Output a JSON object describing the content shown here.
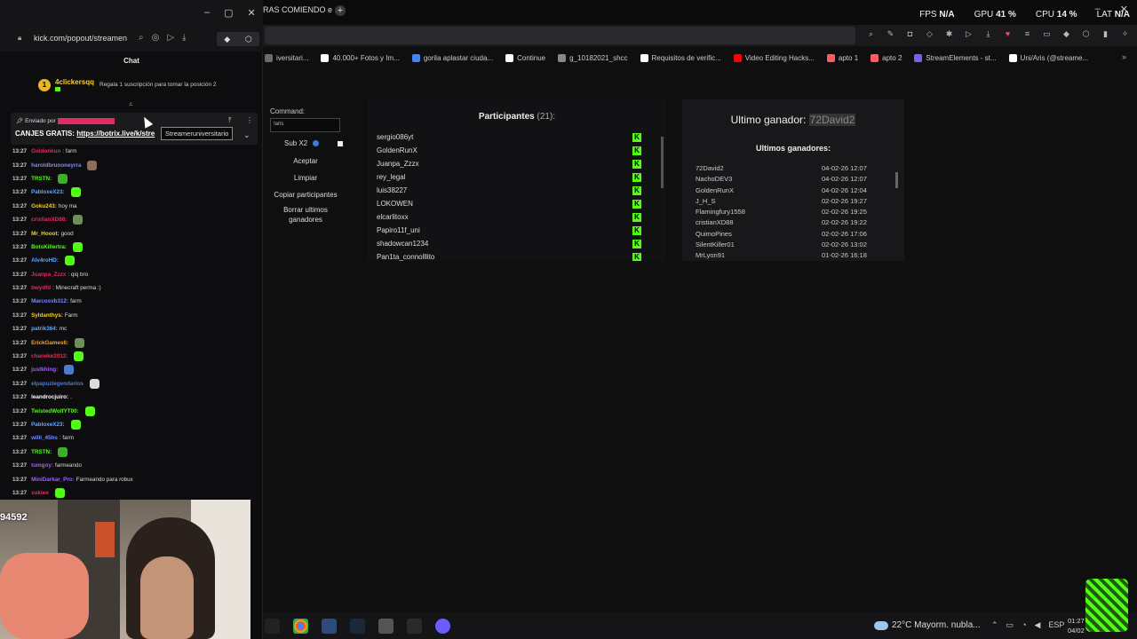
{
  "main": {
    "tab_title": "RAS COMIENDO e",
    "perf": [
      {
        "label": "FPS",
        "value": "N/A"
      },
      {
        "label": "GPU",
        "value": "41 %"
      },
      {
        "label": "CPU",
        "value": "14 %"
      },
      {
        "label": "LAT",
        "value": "N/A"
      }
    ],
    "bookmarks": [
      {
        "label": "iversitari...",
        "color": "#6b6b6b"
      },
      {
        "label": "40.000+ Fotos y Im...",
        "color": "#ffffff"
      },
      {
        "label": "gorila aplastar ciuda...",
        "color": "#4285f4"
      },
      {
        "label": "Continue",
        "color": "#ffffff"
      },
      {
        "label": "g_10182021_shcc",
        "color": "#888888"
      },
      {
        "label": "Requisitos de verific...",
        "color": "#ffffff"
      },
      {
        "label": "Video Editing Hacks...",
        "color": "#ff0000"
      },
      {
        "label": "apto 1",
        "color": "#ff5a5f"
      },
      {
        "label": "apto 2",
        "color": "#ff5a5f"
      },
      {
        "label": "StreamElements - st...",
        "color": "#7a5cff"
      },
      {
        "label": "Uni/Aris (@streame...",
        "color": "#ffffff"
      }
    ]
  },
  "app": {
    "command_label": "Command:",
    "command_value": "!aris",
    "sub_label": "Sub X2",
    "buttons": [
      "Aceptar",
      "Limpiar",
      "Copiar participantes",
      "Borrar ultimos ganadores"
    ],
    "participants_title": "Participantes",
    "participants_count": "(21):",
    "participants": [
      "sergio086yt",
      "GoldenRunX",
      "Juanpa_Zzzx",
      "rey_legal",
      "luis38227",
      "LOKOWEN",
      "elcarlitoxx",
      "Papiro11f_uni",
      "shadowcan1234",
      "Pan1ta_connolllito"
    ],
    "winner_prefix": "Ultimo ganador:",
    "winner_name": "72David2",
    "last_winners_title": "Ultimos ganadores:",
    "winners": [
      {
        "name": "72David2",
        "date": "04-02-26 12:07"
      },
      {
        "name": "NachoDEV3",
        "date": "04-02-26 12:07"
      },
      {
        "name": "GoldenRunX",
        "date": "04-02-26 12:04"
      },
      {
        "name": "J_H_S",
        "date": "02-02-26 19:27"
      },
      {
        "name": "Flamingfury1558",
        "date": "02-02-26 19:25"
      },
      {
        "name": "cristianXD88",
        "date": "02-02-26 19:22"
      },
      {
        "name": "QuimoPines",
        "date": "02-02-26 17:06"
      },
      {
        "name": "SilentKiller01",
        "date": "02-02-26 13:02"
      },
      {
        "name": "MrLyon91",
        "date": "01-02-26 16:18"
      }
    ]
  },
  "chat": {
    "url": "kick.com/popout/streamen",
    "header": "Chat",
    "top_gifter_name": "4clickersqq",
    "top_gifter_rank": "1",
    "top_gifter_text": "Regala 1 suscripción para tomar la posición 2",
    "pinned_by_label": "Enviado por",
    "pinned_text": "CANJES GRATIS:",
    "pinned_link": "https://botrix.live/k/stre",
    "pinned_tooltip": "Streameruniversitario",
    "messages": [
      {
        "time": "13:27",
        "user": "Goldonkun",
        "color": "#e22a63",
        "text": ": farm",
        "emote": ""
      },
      {
        "time": "13:27",
        "user": "haroldbrunoneyrra",
        "color": "#7a8cff",
        "text": "",
        "emote": "#8b6d5c"
      },
      {
        "time": "13:27",
        "user": "TRSTN:",
        "color": "#53fc18",
        "text": "",
        "emote": "#3fae2a"
      },
      {
        "time": "13:27",
        "user": "PabloxeX23:",
        "color": "#5fa9ff",
        "text": "",
        "emote": "#53fc18"
      },
      {
        "time": "13:27",
        "user": "Goku243:",
        "color": "#f5d020",
        "text": " hoy ma",
        "emote": ""
      },
      {
        "time": "13:27",
        "user": "cristianXD88:",
        "color": "#e22a63",
        "text": "",
        "emote": "#6f8f5a"
      },
      {
        "time": "13:27",
        "user": "Mr_Hooot:",
        "color": "#f5d020",
        "text": " good",
        "emote": ""
      },
      {
        "time": "13:27",
        "user": "BotsKillertra:",
        "color": "#53fc18",
        "text": "",
        "emote": "#53fc18"
      },
      {
        "time": "13:27",
        "user": "Alv4roHD:",
        "color": "#5fa9ff",
        "text": "",
        "emote": "#53fc18"
      },
      {
        "time": "13:27",
        "user": "Juanpa_Zzzx",
        "color": "#e22a63",
        "text": ": qiq bro",
        "emote": ""
      },
      {
        "time": "13:27",
        "user": "bwydfd",
        "color": "#e22a63",
        "text": ": Minecraft perma :)",
        "emote": ""
      },
      {
        "time": "13:27",
        "user": "Marcosvb312:",
        "color": "#7a8cff",
        "text": " farm",
        "emote": ""
      },
      {
        "time": "13:27",
        "user": "Syldanthys:",
        "color": "#f5d020",
        "text": " Farm",
        "emote": ""
      },
      {
        "time": "13:27",
        "user": "patrik364:",
        "color": "#5fa9ff",
        "text": " mc",
        "emote": ""
      },
      {
        "time": "13:27",
        "user": "ErickGames6:",
        "color": "#ff9f1a",
        "text": "",
        "emote": "#6f8f5a"
      },
      {
        "time": "13:27",
        "user": "chaneke2012:",
        "color": "#e22a63",
        "text": "",
        "emote": "#53fc18"
      },
      {
        "time": "13:27",
        "user": "justkhing:",
        "color": "#a35cff",
        "text": "",
        "emote": "#4a7bd0"
      },
      {
        "time": "13:27",
        "user": "elpapuzlegendarios",
        "color": "#4a7bd0",
        "text": "",
        "emote": "#dddddd"
      },
      {
        "time": "13:27",
        "user": "leandrocjuiro:",
        "color": "#ffffff",
        "text": " .",
        "emote": ""
      },
      {
        "time": "13:27",
        "user": "TwistedWolfYT00:",
        "color": "#53fc18",
        "text": "",
        "emote": "#53fc18"
      },
      {
        "time": "13:27",
        "user": "PabloxeX23:",
        "color": "#5fa9ff",
        "text": "",
        "emote": "#53fc18"
      },
      {
        "time": "13:27",
        "user": "willi_45hs",
        "color": "#7a8cff",
        "text": ": farm",
        "emote": ""
      },
      {
        "time": "13:27",
        "user": "TRSTN:",
        "color": "#53fc18",
        "text": "",
        "emote": "#3fae2a"
      },
      {
        "time": "13:27",
        "user": "tumgoy:",
        "color": "#a35cff",
        "text": " farmeando",
        "emote": ""
      },
      {
        "time": "13:27",
        "user": "MiniDarkar_Pro:",
        "color": "#a35cff",
        "text": " Farmeando para robux",
        "emote": ""
      },
      {
        "time": "13:27",
        "user": "sukiee",
        "color": "#e22a63",
        "text": "",
        "emote": "#53fc18"
      }
    ]
  },
  "webcam": {
    "counter": "94592"
  },
  "taskbar": {
    "weather": "22°C  Mayorm. nubla...",
    "lang": "ESP",
    "time": "01:27",
    "date": "04/02"
  }
}
